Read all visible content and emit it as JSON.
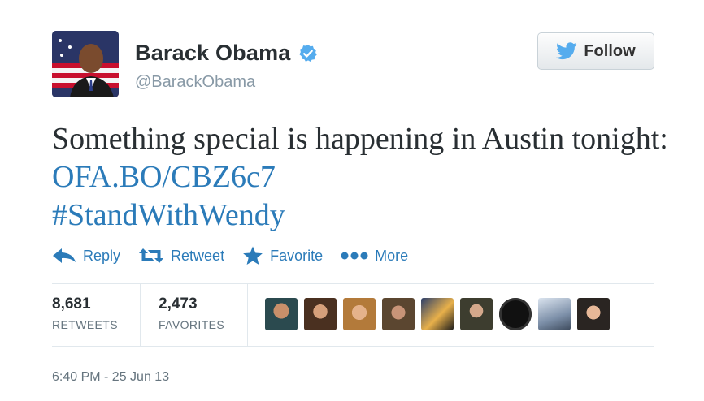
{
  "author": {
    "name": "Barack Obama",
    "handle": "@BarackObama",
    "avatar_icon": "profile-photo",
    "verified_icon": "verified-badge-icon"
  },
  "follow_button": {
    "label": "Follow",
    "icon": "twitter-bird-icon"
  },
  "tweet": {
    "text_before_link": "Something special is happening in Austin tonight: ",
    "link": "OFA.BO/CBZ6c7",
    "hashtag": "#StandWithWendy"
  },
  "actions": [
    {
      "label": "Reply",
      "icon": "reply-arrow-icon"
    },
    {
      "label": "Retweet",
      "icon": "retweet-icon"
    },
    {
      "label": "Favorite",
      "icon": "star-icon"
    },
    {
      "label": "More",
      "icon": "ellipsis-icon"
    }
  ],
  "stats": {
    "retweets": {
      "count": "8,681",
      "label": "RETWEETS"
    },
    "favorites": {
      "count": "2,473",
      "label": "FAVORITES"
    }
  },
  "favorited_by_count_shown": 9,
  "timestamp": "6:40 PM - 25 Jun 13",
  "colors": {
    "link": "#2b7bb9",
    "verified": "#55acee",
    "text": "#292f33",
    "muted": "#66757f"
  }
}
